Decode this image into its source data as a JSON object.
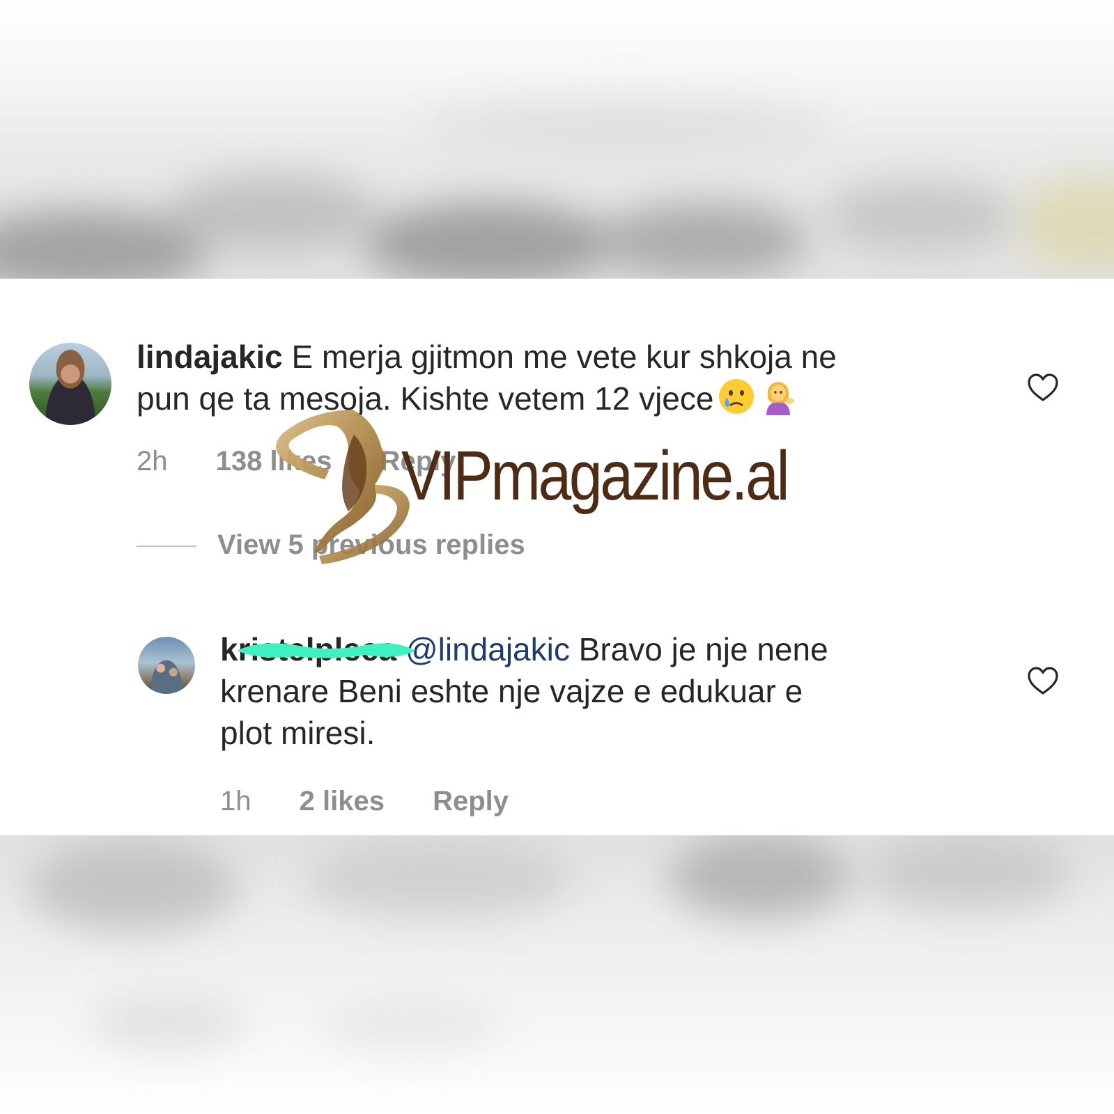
{
  "comments": [
    {
      "username": "lindajakic",
      "text_line1": "E merja gjitmon me vete kur shkoja ne",
      "text_line2": "pun qe ta mesoja. Kishte vetem 12 vjece",
      "emojis": [
        "crying-face-icon",
        "woman-tipping-hand-icon"
      ],
      "time": "2h",
      "likes": "138 likes",
      "reply_label": "Reply"
    },
    {
      "username": "kristelpleca",
      "mention": "@lindajakic",
      "text_line1": "Bravo je nje nene",
      "text_line2": "krenare Beni eshte nje vajze e edukuar e",
      "text_line3": "plot miresi.",
      "time": "1h",
      "likes": "2 likes",
      "reply_label": "Reply"
    }
  ],
  "view_replies_label": "View 5 previous replies",
  "watermark": {
    "text": "VIPmagazine.al"
  },
  "colors": {
    "text": "#262626",
    "meta": "#8e8e8e",
    "mention": "#1e3a6e",
    "redaction": "#3ef2c0",
    "watermark_text": "#4d2b14",
    "watermark_logo": "#b08a4a"
  }
}
